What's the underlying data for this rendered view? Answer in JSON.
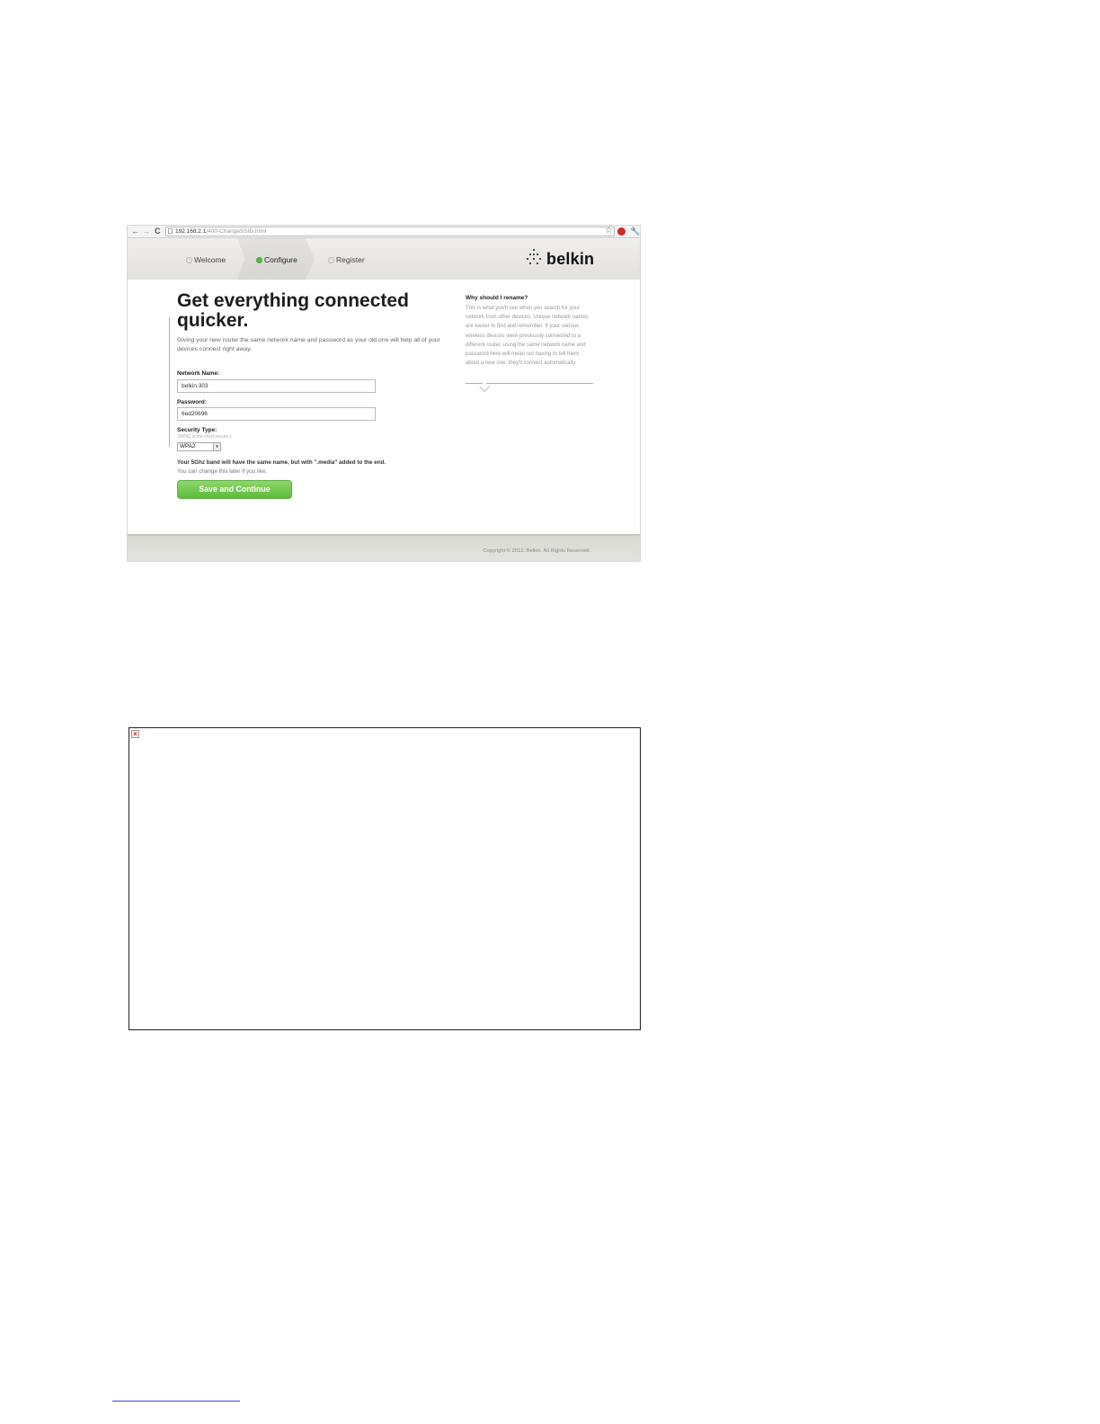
{
  "browser": {
    "back_glyph": "←",
    "forward_glyph": "→",
    "reload_glyph": "C",
    "url_host": "192.168.2.1",
    "url_path": "/400-ChangeSSID.html",
    "bookmark_glyph": "☆",
    "wrench_glyph": "🔧"
  },
  "steps": [
    {
      "label": "Welcome",
      "state": "pending"
    },
    {
      "label": "Configure",
      "state": "done"
    },
    {
      "label": "Register",
      "state": "pending"
    }
  ],
  "logo": {
    "text": "belkin"
  },
  "main": {
    "headline": "Get everything connected quicker.",
    "intro": "Giving your new router the same network name and password as your old one will help all of your devices connect right away.",
    "network_name_label": "Network Name:",
    "network_name_value": "belkin.303",
    "password_label": "Password:",
    "password_value": "6ed20696",
    "security_label": "Security Type:",
    "security_hint": "(WPA2 is the most secure.)",
    "security_value": "WPA2",
    "band_note": "Your 5Ghz band will have the same name, but with \".media\" added to the end.",
    "change_note": "You can change this later if you like.",
    "save_button": "Save and Continue"
  },
  "sidebar": {
    "title": "Why should I rename?",
    "text": "This is what you'll see when you search for your network from other devices. Unique network names are easier to find and remember. If your various wireless devices were previously connected to a different router, using the same network name and password here will mean not having to tell them about a new one; they'll connect automatically."
  },
  "footer": {
    "copyright": "Copyright © 2012. Belkin. All Rights Reserved."
  },
  "colors": {
    "accent_green": "#5cbb3c",
    "header_bg": "#e6e5e1"
  },
  "icons": [
    "back-arrow-icon",
    "forward-arrow-icon",
    "reload-icon",
    "page-icon",
    "star-icon",
    "stop-icon",
    "wrench-icon",
    "check-icon",
    "broken-image-icon"
  ]
}
